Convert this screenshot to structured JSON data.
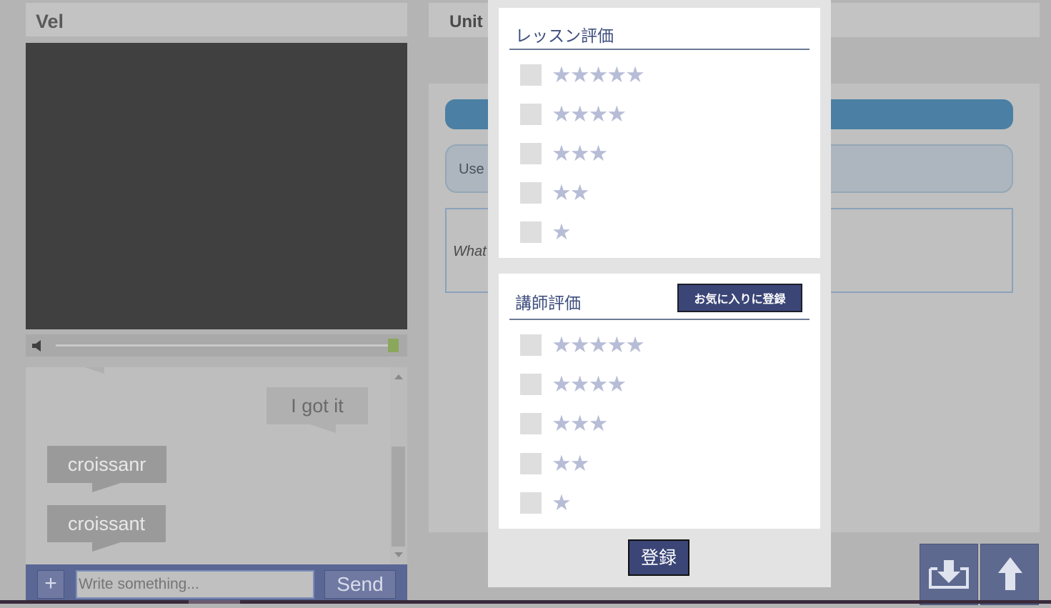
{
  "left_panel": {
    "title": "Vel",
    "volume_level": 1.0,
    "chat": {
      "messages": [
        {
          "text": "I got it",
          "side": "mine"
        },
        {
          "text": "croissanr",
          "side": "theirs"
        },
        {
          "text": "croissant",
          "side": "theirs"
        }
      ]
    },
    "composer": {
      "plus_label": "+",
      "input_placeholder": "Write something...",
      "send_label": "Send"
    }
  },
  "right_panel": {
    "title": "Unit",
    "use_text": "Use",
    "what_text": "What"
  },
  "modal": {
    "lesson_section": {
      "title": "レッスン評価",
      "ratings": [
        "★★★★★",
        "★★★★",
        "★★★",
        "★★",
        "★"
      ]
    },
    "teacher_section": {
      "title": "講師評価",
      "favorite_label": "お気に入りに登録",
      "ratings": [
        "★★★★★",
        "★★★★",
        "★★★",
        "★★",
        "★"
      ]
    },
    "submit_label": "登録"
  },
  "colors": {
    "accent_blue": "#4b7fa3",
    "button_navy": "#3b4677",
    "star_gray": "#b7bdd6"
  },
  "icons": {
    "volume": "speaker-icon",
    "download": "download-icon",
    "up": "arrow-up-icon"
  }
}
